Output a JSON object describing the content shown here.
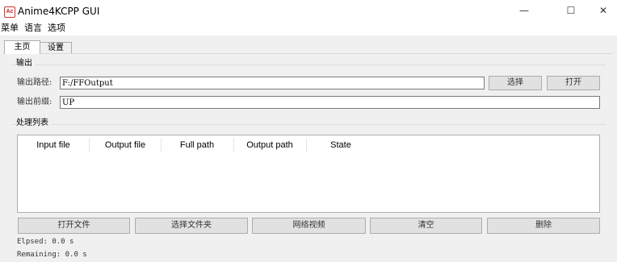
{
  "window": {
    "title": "Anime4KCPP GUI",
    "icon_label": "Ac",
    "minimize_glyph": "—",
    "maximize_glyph": "☐",
    "close_glyph": "✕"
  },
  "menubar": {
    "items": [
      {
        "label": "菜单"
      },
      {
        "label": "语言"
      },
      {
        "label": "选项"
      }
    ]
  },
  "tabs": [
    {
      "label": "主页",
      "active": true
    },
    {
      "label": "设置",
      "active": false
    }
  ],
  "output_group": {
    "title": "输出",
    "path_label": "输出路径:",
    "path_value": "F:/FFOutput",
    "prefix_label": "输出前缀:",
    "prefix_value": "UP",
    "select_button": "选择",
    "open_button": "打开"
  },
  "process_group": {
    "title": "处理列表",
    "columns": [
      "Input file",
      "Output file",
      "Full path",
      "Output path",
      "State"
    ],
    "rows": []
  },
  "actions": [
    {
      "label": "打开文件"
    },
    {
      "label": "选择文件夹"
    },
    {
      "label": "网络视频"
    },
    {
      "label": "清空"
    },
    {
      "label": "删除"
    }
  ],
  "status": {
    "elapsed": "Elpsed: 0.0 s",
    "remaining": "Remaining: 0.0 s"
  }
}
